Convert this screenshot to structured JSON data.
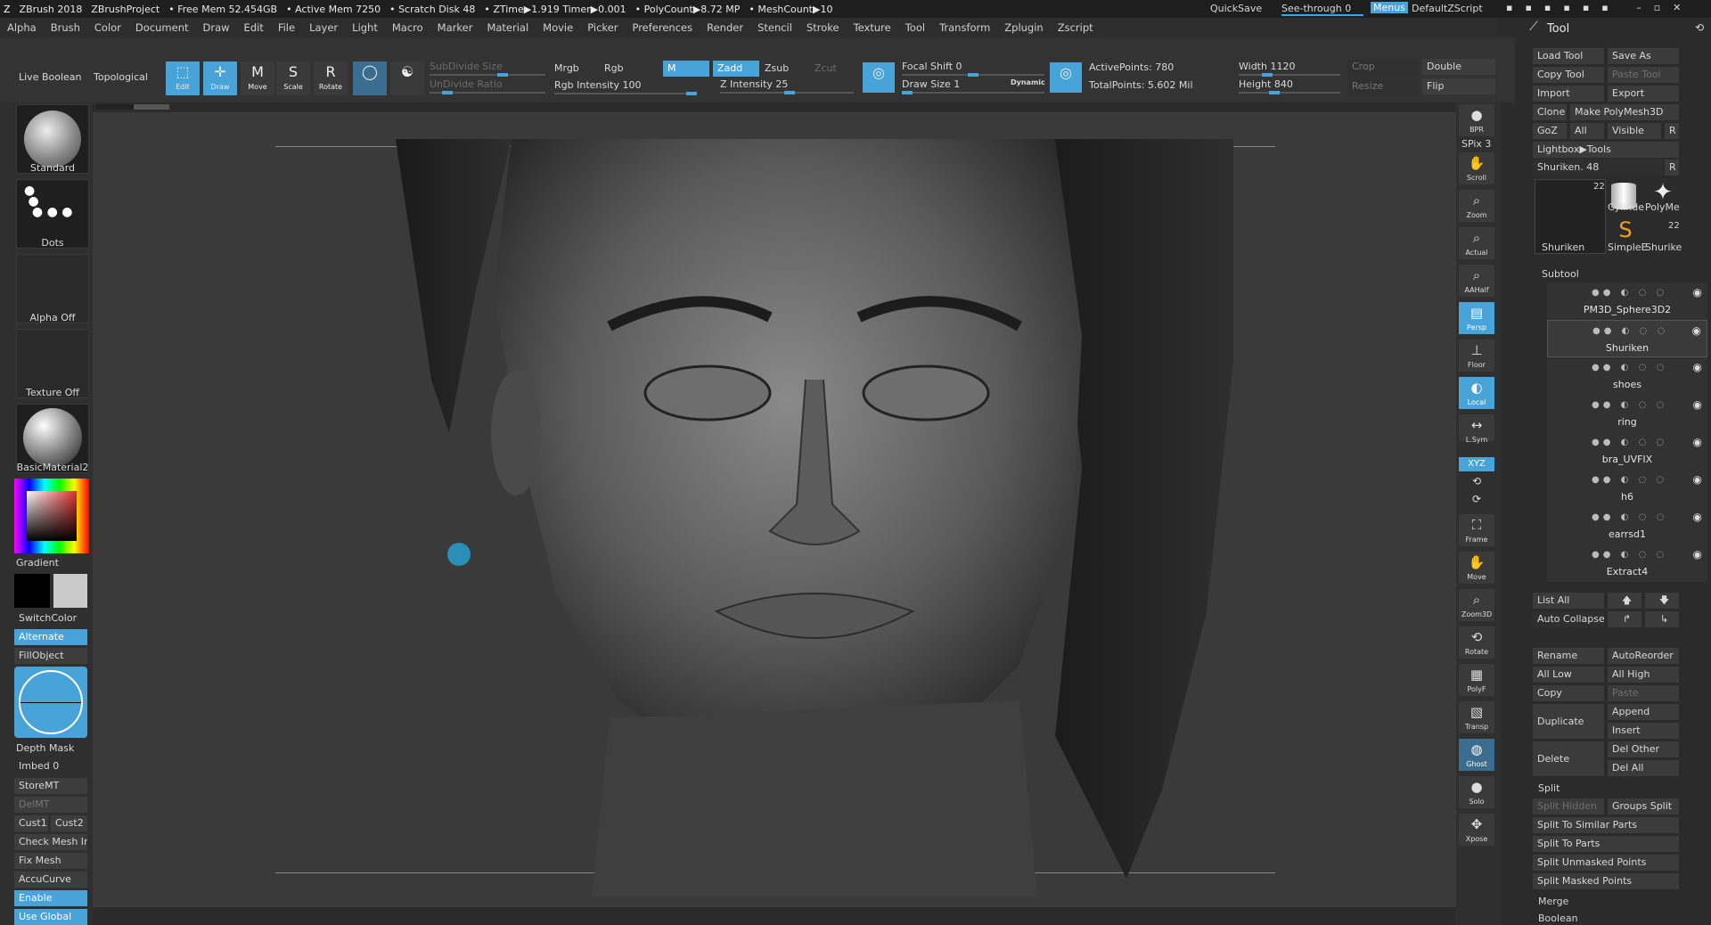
{
  "titlebar": {
    "app": "ZBrush 2018",
    "project": "ZBrushProject",
    "free_mem": "• Free Mem 52.454GB",
    "active_mem": "• Active Mem 7250",
    "scratch": "• Scratch Disk 48",
    "ztime": "• ZTime▶1.919 Timer▶0.001",
    "polycount": "• PolyCount▶8.72 MP",
    "meshcount": "• MeshCount▶10",
    "quicksave": "QuickSave",
    "see_through": "See-through  0",
    "menus": "Menus",
    "script": "DefaultZScript"
  },
  "menu": [
    "Alpha",
    "Brush",
    "Color",
    "Document",
    "Draw",
    "Edit",
    "File",
    "Layer",
    "Light",
    "Macro",
    "Marker",
    "Material",
    "Movie",
    "Picker",
    "Preferences",
    "Render",
    "Stencil",
    "Stroke",
    "Texture",
    "Tool",
    "Transform",
    "Zplugin",
    "Zscript"
  ],
  "toolbar": {
    "live_boolean": "Live Boolean",
    "topological": "Topological",
    "edit": "Edit",
    "draw": "Draw",
    "move": "Move",
    "scale": "Scale",
    "rotate": "Rotate",
    "subdivide_size": "SubDivide Size",
    "undivide_ratio": "UnDivide Ratio",
    "mrgb": "Mrgb",
    "rgb": "Rgb",
    "rgb_intensity": "Rgb Intensity 100",
    "m": "M",
    "zadd": "Zadd",
    "zsub": "Zsub",
    "zcut": "Zcut",
    "z_intensity": "Z Intensity 25",
    "focal_shift": "Focal Shift 0",
    "draw_size": "Draw Size 1",
    "dynamic": "Dynamic",
    "active_points": "ActivePoints: 780",
    "total_points": "TotalPoints:  5.602 Mil",
    "width": "Width 1120",
    "height": "Height 840",
    "crop": "Crop",
    "resize": "Resize",
    "double": "Double",
    "flip": "Flip"
  },
  "left": {
    "standard": "Standard",
    "dots": "Dots",
    "alpha": "Alpha Off",
    "texture": "Texture Off",
    "material": "BasicMaterial2",
    "gradient": "Gradient",
    "switch_color": "SwitchColor",
    "alternate": "Alternate",
    "fill_object": "FillObject",
    "depth_mask": "Depth Mask",
    "imbed": "Imbed 0",
    "store_mt": "StoreMT",
    "del_mt": "DelMT",
    "cust1": "Cust1",
    "cust2": "Cust2",
    "check_mesh": "Check Mesh In",
    "fix_mesh": "Fix Mesh",
    "accucurve": "AccuCurve",
    "enable": "Enable",
    "use_global": "Use Global"
  },
  "right": {
    "bpr": "BPR",
    "spix": "SPix 3",
    "scroll": "Scroll",
    "zoom": "Zoom",
    "actual": "Actual",
    "aahalf": "AAHalf",
    "persp": "Persp",
    "floor": "Floor",
    "local": "Local",
    "lsym": "L.Sym",
    "xyz": "XYZ",
    "frame": "Frame",
    "move": "Move",
    "zoom3d": "Zoom3D",
    "rotate": "Rotate",
    "polyf": "PolyF",
    "transp": "Transp",
    "ghost": "Ghost",
    "solo": "Solo",
    "xpose": "Xpose"
  },
  "tool": {
    "title": "Tool",
    "load": "Load Tool",
    "save_as": "Save As",
    "copy": "Copy Tool",
    "paste": "Paste Tool",
    "import": "Import",
    "export": "Export",
    "clone": "Clone",
    "make_polymesh": "Make PolyMesh3D",
    "goz": "GoZ",
    "all": "All",
    "visible": "Visible",
    "r": "R",
    "lightbox": "Lightbox▶Tools",
    "shuriken": "Shuriken. 48",
    "thumb_count": "22",
    "thumb_count2": "22",
    "thumb1": "Shuriken",
    "thumb2": "Cylinde",
    "thumb3": "PolyMe",
    "thumb4": "SimpleE",
    "thumb5": "Shurike",
    "subtool": "Subtool",
    "subtools": [
      "PM3D_Sphere3D2",
      "Shuriken",
      "shoes",
      "ring",
      "bra_UVFIX",
      "h6",
      "earrsd1",
      "Extract4"
    ],
    "list_all": "List All",
    "auto_collapse": "Auto Collapse",
    "rename": "Rename",
    "autoreorder": "AutoReorder",
    "all_low": "All Low",
    "all_high": "All High",
    "copy2": "Copy",
    "paste2": "Paste",
    "duplicate": "Duplicate",
    "append": "Append",
    "insert": "Insert",
    "delete": "Delete",
    "del_other": "Del Other",
    "del_all": "Del All",
    "split": "Split",
    "split_hidden": "Split Hidden",
    "groups_split": "Groups Split",
    "split_similar": "Split To Similar Parts",
    "split_parts": "Split To Parts",
    "split_unmasked": "Split Unmasked Points",
    "split_masked": "Split Masked Points",
    "merge": "Merge",
    "boolean": "Boolean"
  },
  "colors": {
    "accent": "#48a3d9",
    "panel": "#333333",
    "canvas": "#3a3a3a"
  }
}
